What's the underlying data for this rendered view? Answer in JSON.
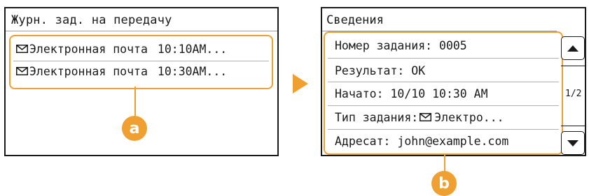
{
  "left_screen": {
    "title": "Журн. зад. на передачу",
    "items": [
      {
        "icon": "mail-icon",
        "type": "Электронная почта",
        "time": "10:10AM..."
      },
      {
        "icon": "mail-icon",
        "type": "Электронная почта",
        "time": "10:30AM..."
      }
    ],
    "callout": "a"
  },
  "arrow": {
    "color": "#f0a030"
  },
  "right_screen": {
    "title": "Сведения",
    "rows": [
      {
        "label": "Номер задания: 0005"
      },
      {
        "label": "Результат: OK"
      },
      {
        "label": "Начато: 10/10 10:30 AM"
      },
      {
        "label_prefix": "Тип задания:",
        "icon": "mail-icon",
        "label_suffix": "Электро..."
      },
      {
        "label": "Адресат: john@example.com"
      }
    ],
    "page_indicator": "1/2",
    "callout": "b"
  },
  "colors": {
    "accent": "#f0a030",
    "border": "#1a1a1a"
  }
}
